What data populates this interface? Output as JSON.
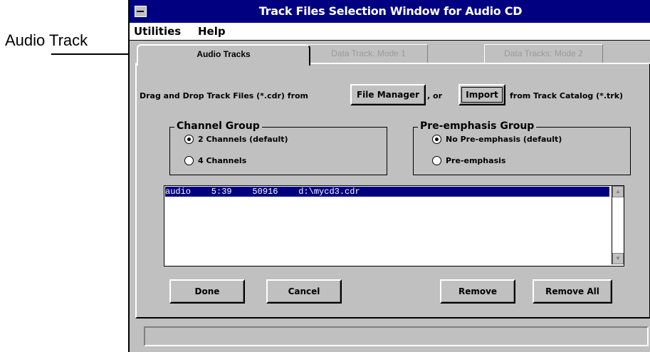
{
  "callout": {
    "label": "Audio Track"
  },
  "window": {
    "title": "Track Files Selection Window for Audio CD"
  },
  "menu": {
    "utilities": "Utilities",
    "help": "Help"
  },
  "tabs": [
    {
      "label": "Audio Tracks",
      "active": true
    },
    {
      "label": "Data Track:  Mode 1",
      "active": false
    },
    {
      "label": "Data Tracks:  Mode 2",
      "active": false
    }
  ],
  "instructions": {
    "prefix": "Drag and Drop Track Files (*.cdr) from",
    "file_manager_button": "File Manager",
    "middle": ", or",
    "import_button": "Import",
    "suffix": "from Track Catalog (*.trk)"
  },
  "channel_group": {
    "label": "Channel Group",
    "options": [
      {
        "label": "2 Channels (default)",
        "checked": true
      },
      {
        "label": "4 Channels",
        "checked": false
      }
    ]
  },
  "preemphasis_group": {
    "label": "Pre-emphasis Group",
    "options": [
      {
        "label": "No Pre-emphasis (default)",
        "checked": true
      },
      {
        "label": "Pre-emphasis",
        "checked": false
      }
    ]
  },
  "track_list": {
    "rows": [
      {
        "text": "audio    5:39    50916    d:\\mycd3.cdr"
      }
    ]
  },
  "buttons": {
    "done": "Done",
    "cancel": "Cancel",
    "remove": "Remove",
    "remove_all": "Remove All"
  },
  "colors": {
    "title_bar": "#000080",
    "face": "#c0c0c0",
    "selection": "#000080"
  }
}
